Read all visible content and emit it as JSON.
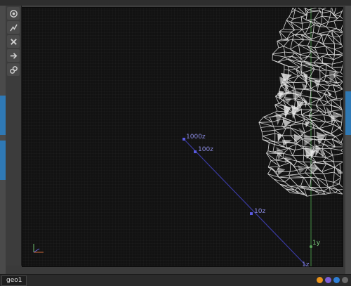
{
  "toolbar": {
    "tools": [
      {
        "name": "view-icon"
      },
      {
        "name": "draw-icon"
      },
      {
        "name": "close-icon"
      },
      {
        "name": "arrow-icon"
      },
      {
        "name": "link-icon"
      }
    ]
  },
  "viewport": {
    "markers": {
      "m1000": "1000z",
      "m100": "100z",
      "m10": "10z",
      "m1": "1z",
      "y1": "1y"
    }
  },
  "status": {
    "node_name": "geo1",
    "indicators": [
      {
        "name": "orange-indicator",
        "color": "#e8921a"
      },
      {
        "name": "purple-indicator",
        "color": "#7b5ed6"
      },
      {
        "name": "blue-indicator",
        "color": "#2f7fd6"
      },
      {
        "name": "gray-indicator",
        "color": "#6a6a6a"
      }
    ]
  },
  "colors": {
    "z_axis": "#3a3aa0",
    "y_axis": "#3d7a3d",
    "wireframe": "#d8d8d8"
  }
}
